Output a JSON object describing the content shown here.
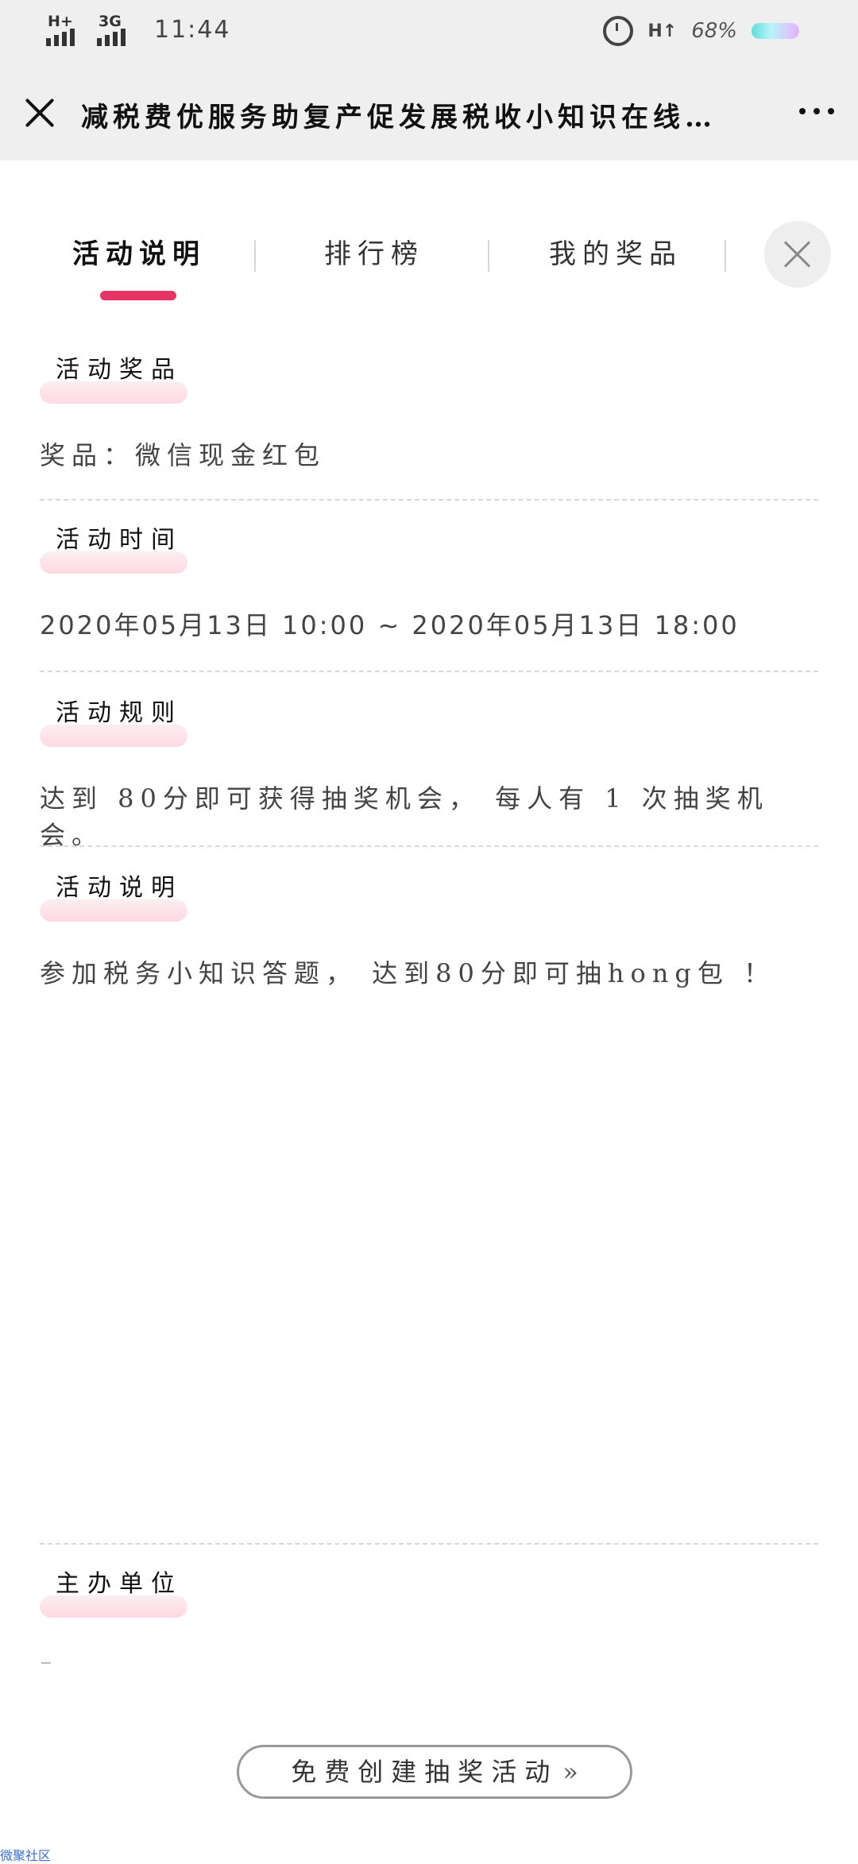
{
  "status_bar": {
    "time": "11:44",
    "signal1": "H+",
    "signal2": "3G",
    "network_right": "H↑",
    "battery": "68%"
  },
  "header": {
    "title": "减税费优服务助复产促发展税收小知识在线答题",
    "close_icon": "close-icon",
    "more_icon": "more-dots-icon"
  },
  "tabs": [
    {
      "label": "活动说明"
    },
    {
      "label": "排行榜"
    },
    {
      "label": "我的奖品"
    }
  ],
  "sections": {
    "prize": {
      "title": "活动奖品",
      "body": "奖品：微信现金红包"
    },
    "time": {
      "title": "活动时间",
      "body": "2020年05月13日 10:00 ~ 2020年05月13日 18:00"
    },
    "rules": {
      "title": "活动规则",
      "body": "达到 80分即可获得抽奖机会， 每人有 1 次抽奖机会。"
    },
    "desc": {
      "title": "活动说明",
      "body": "参加税务小知识答题， 达到80分即可抽hong包 ！"
    },
    "organizer": {
      "title": "主办单位"
    }
  },
  "cta": {
    "label": "免费创建抽奖活动",
    "chevron": "»"
  },
  "footer": {
    "brand": "微聚社区"
  },
  "colors": {
    "accent": "#e63467",
    "header_bg": "#efefef",
    "section_title_underlay": "#ffd9e2"
  }
}
